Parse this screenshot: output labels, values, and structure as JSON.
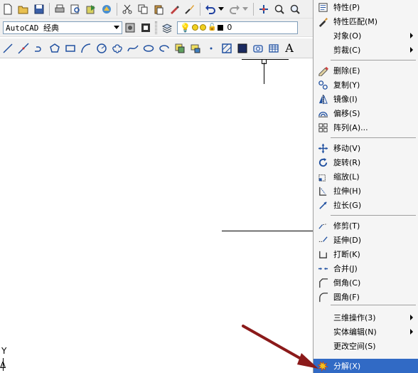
{
  "toolbar_standard": {
    "icons": [
      "new-icon",
      "open-icon",
      "save-icon",
      "print-icon",
      "plot-preview-icon",
      "publish-icon",
      "3d-dwf-icon",
      "cut-icon",
      "copy-icon",
      "paste-icon",
      "match-properties-icon",
      "block-editor-icon",
      "undo-icon",
      "redo-icon",
      "pan-icon",
      "zoom-icon",
      "zoom-window-icon"
    ]
  },
  "workspace": {
    "selected": "AutoCAD 经典"
  },
  "layer": {
    "selected": "0"
  },
  "toolbar_draw": {
    "icons": [
      "line-icon",
      "construction-line-icon",
      "polyline-icon",
      "polygon-icon",
      "rectangle-icon",
      "arc-icon",
      "circle-icon",
      "revision-cloud-icon",
      "spline-icon",
      "ellipse-icon",
      "ellipse-arc-icon",
      "insert-block-icon",
      "make-block-icon",
      "point-icon",
      "hatch-icon",
      "gradient-icon",
      "region-icon",
      "table-icon",
      "multiline-text-icon"
    ],
    "text_glyph": "A"
  },
  "ucs": {
    "y_label": "Y"
  },
  "context_menu": {
    "items": [
      {
        "label": "特性(P)",
        "icon": "properties-icon"
      },
      {
        "label": "特性匹配(M)",
        "icon": "match-properties-icon"
      },
      {
        "label": "对象(O)",
        "icon": "",
        "submenu": true
      },
      {
        "label": "剪裁(C)",
        "icon": "",
        "submenu": true
      },
      {
        "label": "删除(E)",
        "icon": "erase-icon"
      },
      {
        "label": "复制(Y)",
        "icon": "copy-object-icon"
      },
      {
        "label": "镜像(I)",
        "icon": "mirror-icon"
      },
      {
        "label": "偏移(S)",
        "icon": "offset-icon"
      },
      {
        "label": "阵列(A)...",
        "icon": "array-icon"
      },
      {
        "label": "移动(V)",
        "icon": "move-icon"
      },
      {
        "label": "旋转(R)",
        "icon": "rotate-icon"
      },
      {
        "label": "缩放(L)",
        "icon": "scale-icon"
      },
      {
        "label": "拉伸(H)",
        "icon": "stretch-icon"
      },
      {
        "label": "拉长(G)",
        "icon": "lengthen-icon"
      },
      {
        "label": "修剪(T)",
        "icon": "trim-icon"
      },
      {
        "label": "延伸(D)",
        "icon": "extend-icon"
      },
      {
        "label": "打断(K)",
        "icon": "break-icon"
      },
      {
        "label": "合并(J)",
        "icon": "join-icon"
      },
      {
        "label": "倒角(C)",
        "icon": "chamfer-icon"
      },
      {
        "label": "圆角(F)",
        "icon": "fillet-icon"
      },
      {
        "label": "三维操作(3)",
        "icon": "",
        "submenu": true
      },
      {
        "label": "实体编辑(N)",
        "icon": "",
        "submenu": true
      },
      {
        "label": "更改空间(S)",
        "icon": ""
      },
      {
        "label": "分解(X)",
        "icon": "explode-icon"
      }
    ],
    "highlighted_index": 23,
    "highlight_color": "#316ac5"
  },
  "colors": {
    "toolbar_bg": "#f0f0f0",
    "annotation_arrow": "#8b1a1a"
  }
}
